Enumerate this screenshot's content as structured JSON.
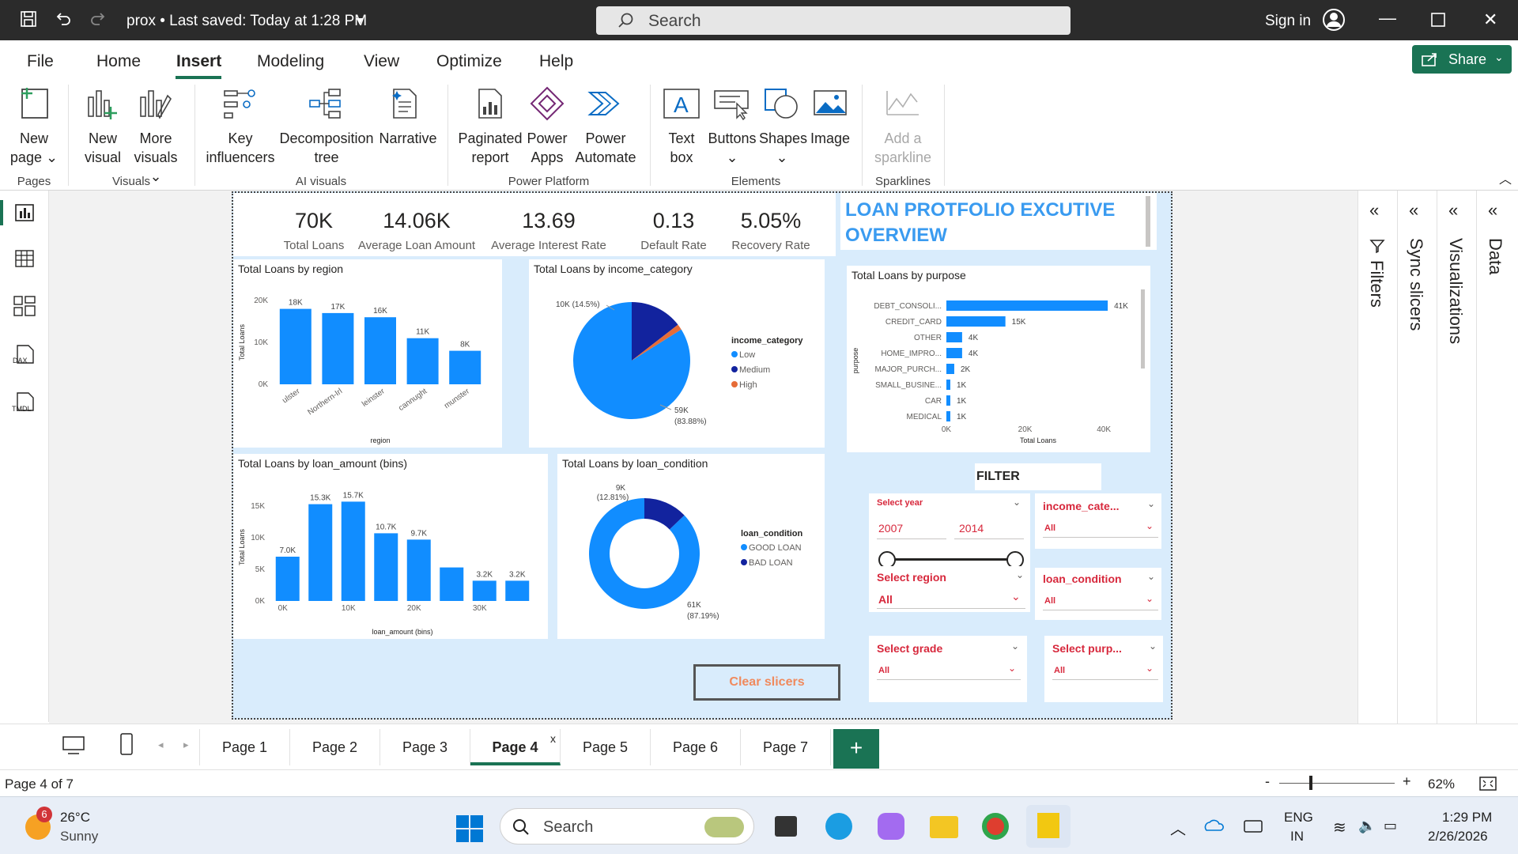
{
  "titlebar": {
    "doc_title": "prox • Last saved: Today at 1:28 PM",
    "search": "Search",
    "signin": "Sign in"
  },
  "menu": {
    "items": [
      "File",
      "Home",
      "Insert",
      "Modeling",
      "View",
      "Optimize",
      "Help"
    ],
    "active": "Insert",
    "share": "Share"
  },
  "ribbon": {
    "new_page": "New page",
    "new_visual": "New visual",
    "more_visuals": "More visuals",
    "key_influencers": "Key influencers",
    "decomposition_tree": "Decomposition tree",
    "narrative": "Narrative",
    "paginated_report": "Paginated report",
    "power_apps": "Power Apps",
    "power_automate": "Power Automate",
    "text_box": "Text box",
    "buttons": "Buttons",
    "shapes": "Shapes",
    "image": "Image",
    "add_sparkline": "Add a sparkline",
    "groups": {
      "pages": "Pages",
      "visuals": "Visuals",
      "ai_visuals": "AI visuals",
      "power_platform": "Power Platform",
      "elements": "Elements",
      "sparklines": "Sparklines"
    }
  },
  "kpis": [
    {
      "value": "70K",
      "label": "Total Loans"
    },
    {
      "value": "14.06K",
      "label": "Average Loan Amount"
    },
    {
      "value": "13.69",
      "label": "Average Interest Rate"
    },
    {
      "value": "0.13",
      "label": "Default Rate"
    },
    {
      "value": "5.05%",
      "label": "Recovery Rate"
    }
  ],
  "report_title": "LOAN PROTFOLIO EXCUTIVE OVERVIEW",
  "chart_data": [
    {
      "type": "bar",
      "title": "Total Loans by region",
      "xlabel": "region",
      "ylabel": "Total Loans",
      "categories": [
        "ulster",
        "Northern-Irl",
        "leinster",
        "cannught",
        "munster"
      ],
      "values": [
        18000,
        17000,
        16000,
        11000,
        8000
      ],
      "data_labels": [
        "18K",
        "17K",
        "16K",
        "11K",
        "8K"
      ],
      "y_ticks": [
        "20K",
        "10K",
        "0K"
      ],
      "ylim": [
        0,
        20000
      ]
    },
    {
      "type": "pie",
      "title": "Total Loans by income_category",
      "legend_title": "income_category",
      "series": [
        {
          "name": "Low",
          "value": 59000,
          "label": "59K",
          "pct": "(83.88%)",
          "color": "#118dff"
        },
        {
          "name": "Medium",
          "value": 10200,
          "label": "10K (14.5%)",
          "color": "#12239e"
        },
        {
          "name": "High",
          "value": 1100,
          "color": "#e66c37"
        }
      ]
    },
    {
      "type": "bar",
      "title": "Total Loans by loan_amount (bins)",
      "xlabel": "loan_amount (bins)",
      "ylabel": "Total Loans",
      "categories": [
        "0K",
        "",
        "10K",
        "",
        "20K",
        "",
        "30K",
        ""
      ],
      "values": [
        7000,
        15300,
        15700,
        10700,
        9700,
        5300,
        3200,
        3200
      ],
      "data_labels": [
        "7.0K",
        "15.3K",
        "15.7K",
        "10.7K",
        "9.7K",
        "",
        "3.2K",
        "3.2K"
      ],
      "x_ticks": [
        "0K",
        "10K",
        "20K",
        "30K"
      ],
      "y_ticks": [
        "15K",
        "10K",
        "5K",
        "0K"
      ],
      "ylim": [
        0,
        17000
      ]
    },
    {
      "type": "pie",
      "title": "Total Loans by loan_condition",
      "legend_title": "loan_condition",
      "series": [
        {
          "name": "GOOD LOAN",
          "value": 61000,
          "label": "61K",
          "pct": "(87.19%)",
          "color": "#118dff"
        },
        {
          "name": "BAD LOAN",
          "value": 9000,
          "label": "9K",
          "pct": "(12.81%)",
          "color": "#12239e"
        }
      ]
    },
    {
      "type": "bar",
      "orientation": "horizontal",
      "title": "Total Loans by purpose",
      "xlabel": "Total Loans",
      "ylabel": "purpose",
      "categories": [
        "DEBT_CONSOLI...",
        "CREDIT_CARD",
        "OTHER",
        "HOME_IMPRO...",
        "MAJOR_PURCH...",
        "SMALL_BUSINE...",
        "CAR",
        "MEDICAL"
      ],
      "values": [
        41000,
        15000,
        4000,
        4000,
        2000,
        1000,
        1000,
        1000
      ],
      "data_labels": [
        "41K",
        "15K",
        "4K",
        "4K",
        "2K",
        "1K",
        "1K",
        "1K"
      ],
      "x_ticks": [
        "0K",
        "20K",
        "40K"
      ],
      "xlim": [
        0,
        45000
      ]
    }
  ],
  "filter": {
    "title": "FILTER",
    "year": {
      "title": "Select year",
      "from": "2007",
      "to": "2014"
    },
    "income": {
      "title": "income_cate...",
      "value": "All"
    },
    "region": {
      "title": "Select region",
      "value": "All"
    },
    "loan_condition": {
      "title": "loan_condition",
      "value": "All"
    },
    "grade": {
      "title": "Select grade",
      "value": "All"
    },
    "purpose": {
      "title": "Select purp...",
      "value": "All"
    },
    "clear": "Clear slicers"
  },
  "panes": [
    "Filters",
    "Sync slicers",
    "Visualizations",
    "Data"
  ],
  "tabs": [
    "Page 1",
    "Page 2",
    "Page 3",
    "Page 4",
    "Page 5",
    "Page 6",
    "Page 7"
  ],
  "active_tab": "Page 4",
  "status": {
    "page": "Page 4 of 7",
    "zoom": "62%"
  },
  "taskbar": {
    "badge": "6",
    "temp": "26°C",
    "weather": "Sunny",
    "search": "Search",
    "lang1": "ENG",
    "lang2": "IN",
    "time": "1:29 PM",
    "date": "2/26/2026"
  }
}
